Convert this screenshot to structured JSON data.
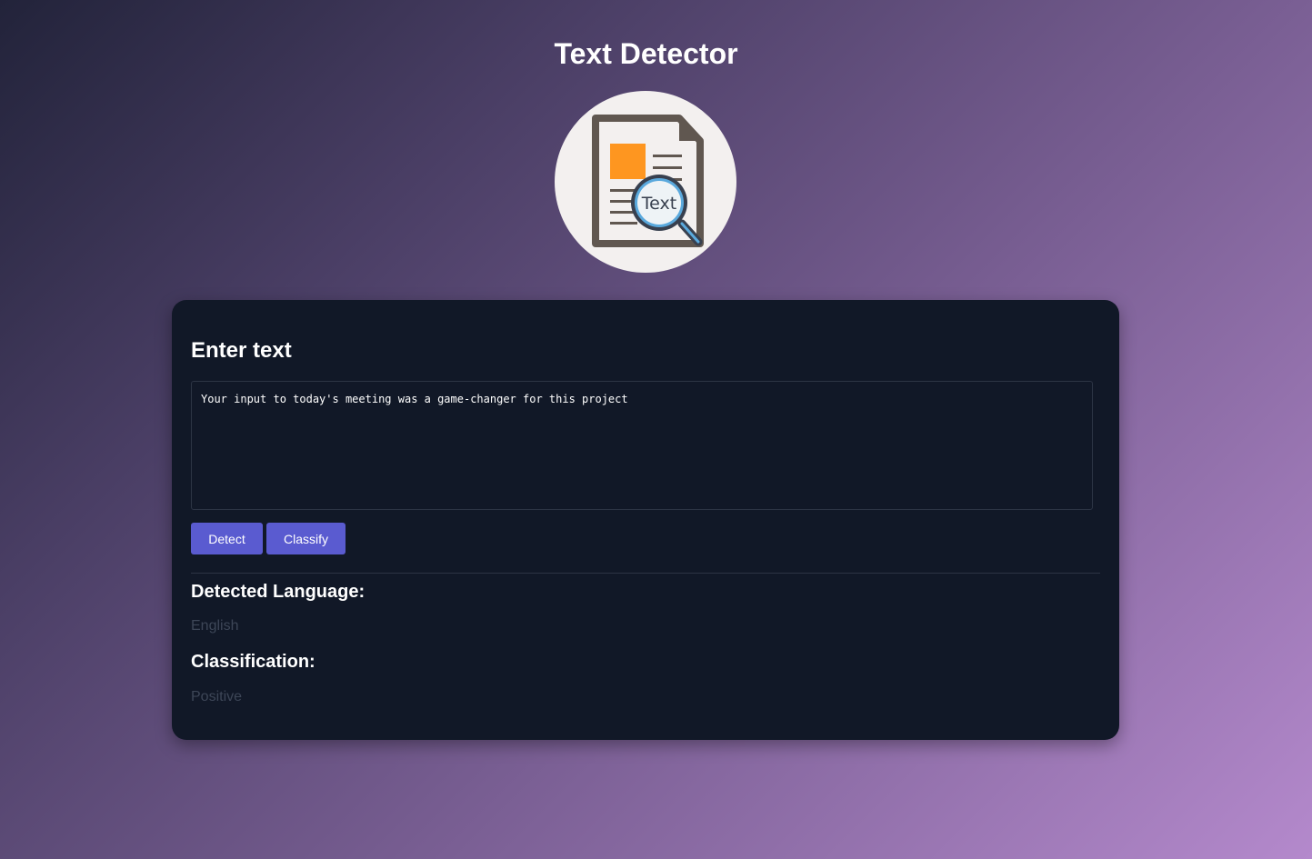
{
  "header": {
    "title": "Text Detector",
    "logo_icon": "document-magnifier-icon",
    "logo_text": "Text"
  },
  "form": {
    "title": "Enter text",
    "input_value": "Your input to today's meeting was a game-changer for this project",
    "detect_label": "Detect",
    "classify_label": "Classify"
  },
  "results": {
    "language_label": "Detected Language:",
    "language_value": "English",
    "classification_label": "Classification:",
    "classification_value": "Positive"
  },
  "colors": {
    "accent": "#5a5bd0",
    "card_background": "#111827",
    "logo_orange": "#fe9620",
    "document_outline": "#605750",
    "magnifier_ring": "#5aa9dd"
  }
}
